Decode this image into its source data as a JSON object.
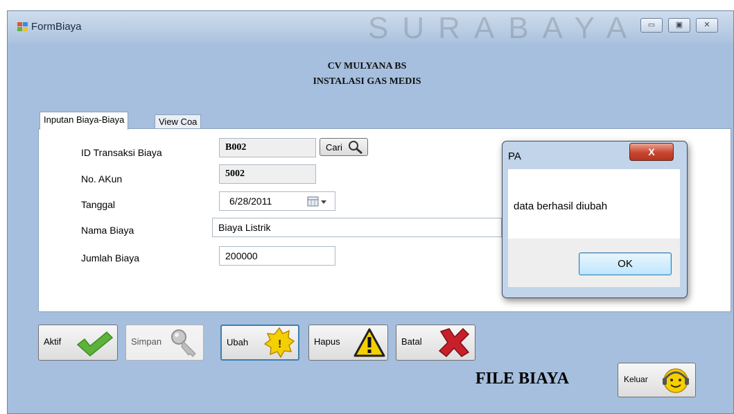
{
  "window": {
    "title": "FormBiaya",
    "watermark": "SURABAYA",
    "controls": {
      "minimize": "▭",
      "maximize": "▣",
      "close": "✕"
    }
  },
  "header": {
    "company": "CV MULYANA BS",
    "subtitle": "INSTALASI GAS MEDIS"
  },
  "tabs": [
    {
      "label": "Inputan Biaya-Biaya",
      "active": true
    },
    {
      "label": "View Coa",
      "active": false
    }
  ],
  "form": {
    "id_label": "ID Transaksi Biaya",
    "id_value": "B002",
    "search_label": "Cari",
    "akun_label": "No. AKun",
    "akun_value": "5002",
    "tanggal_label": "Tanggal",
    "tanggal_value": "6/28/2011",
    "nama_label": "Nama Biaya",
    "nama_value": "Biaya Listrik",
    "jumlah_label": "Jumlah Biaya",
    "jumlah_value": "200000"
  },
  "dialog": {
    "title": "PA",
    "close_label": "X",
    "message": "data berhasil diubah",
    "ok_label": "OK"
  },
  "actions": {
    "aktif": "Aktif",
    "simpan": "Simpan",
    "ubah": "Ubah",
    "hapus": "Hapus",
    "batal": "Batal"
  },
  "footer": {
    "title": "FILE BIAYA",
    "keluar": "Keluar"
  },
  "colors": {
    "form_background": "#a6bfde",
    "check_green": "#5db33a",
    "cross_red": "#c8202a",
    "warning_yellow": "#f5d000"
  },
  "icons": [
    "app-form-icon",
    "magnifier-icon",
    "calendar-icon",
    "check-icon",
    "key-icon",
    "gear-warning-icon",
    "warning-triangle-icon",
    "red-x-icon",
    "smiley-headset-icon"
  ]
}
